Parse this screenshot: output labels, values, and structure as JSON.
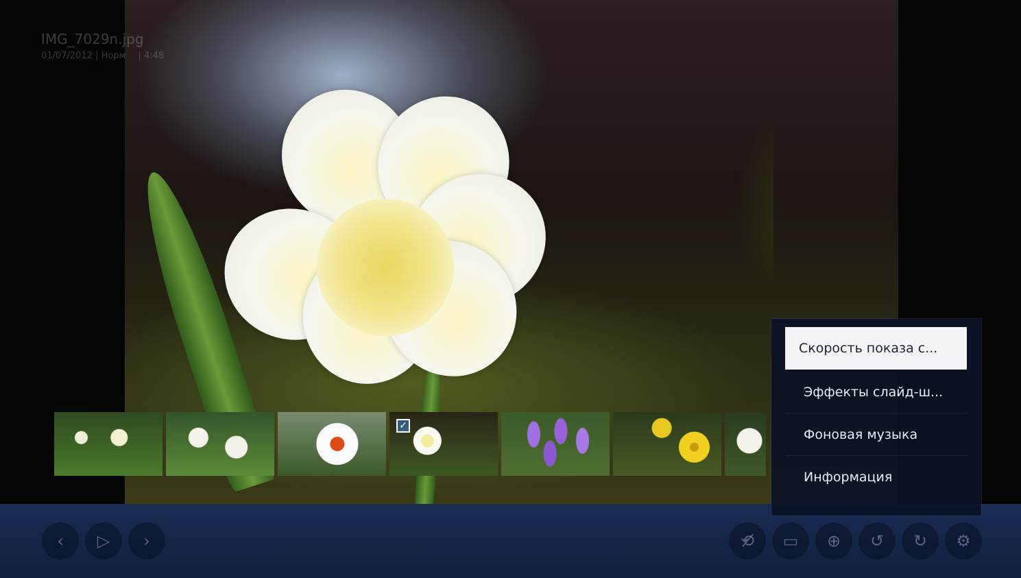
{
  "file": {
    "name": "IMG_7029n.jpg",
    "meta": "01/07/2012 | Норм",
    "time": "| 4:48"
  },
  "thumbnails": [
    {
      "name": "daffodils-white-yellow",
      "selected": false
    },
    {
      "name": "daffodils-white",
      "selected": false
    },
    {
      "name": "daffodil-red-center",
      "selected": false
    },
    {
      "name": "daffodil-current",
      "selected": true
    },
    {
      "name": "crocuses-purple",
      "selected": false
    },
    {
      "name": "daffodils-yellow",
      "selected": false
    },
    {
      "name": "daffodil-partial",
      "selected": false
    }
  ],
  "context_menu": {
    "items": [
      {
        "label": "Скорость показа с...",
        "focused": true
      },
      {
        "label": "Эффекты слайд-ш...",
        "focused": false
      },
      {
        "label": "Фоновая музыка",
        "focused": false
      },
      {
        "label": "Информация",
        "focused": false
      }
    ]
  },
  "controls": {
    "left": [
      {
        "name": "previous",
        "icon": "chevron-left-icon",
        "glyph": "‹"
      },
      {
        "name": "play",
        "icon": "play-icon",
        "glyph": "▷"
      },
      {
        "name": "next",
        "icon": "chevron-right-icon",
        "glyph": "›"
      }
    ],
    "right": [
      {
        "name": "rotate-off",
        "icon": "no-rotate-icon",
        "glyph": "⟲̸"
      },
      {
        "name": "fit",
        "icon": "fit-screen-icon",
        "glyph": "▭"
      },
      {
        "name": "zoom",
        "icon": "zoom-icon",
        "glyph": "⊕"
      },
      {
        "name": "rotate-left",
        "icon": "rotate-left-icon",
        "glyph": "↺"
      },
      {
        "name": "rotate-right",
        "icon": "rotate-right-icon",
        "glyph": "↻"
      },
      {
        "name": "settings",
        "icon": "gear-icon",
        "glyph": "⚙"
      }
    ]
  }
}
